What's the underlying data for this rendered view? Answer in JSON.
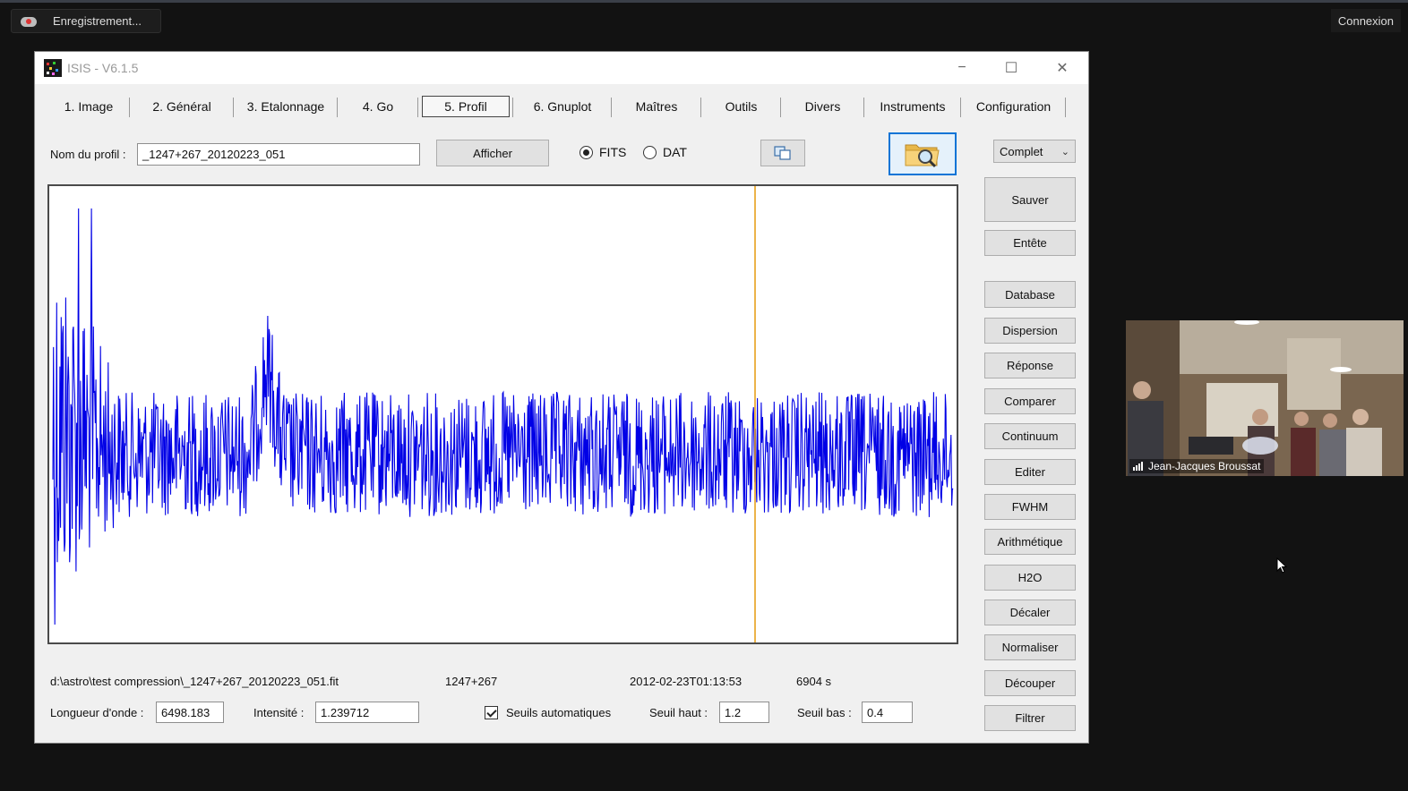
{
  "overlay": {
    "recording_label": "Enregistrement...",
    "connexion_label": "Connexion",
    "participant_name": "Jean-Jacques Broussat"
  },
  "window": {
    "title": "ISIS - V6.1.5",
    "controls": {
      "minimize": "−",
      "maximize": "☐",
      "close": "✕"
    }
  },
  "tabs": [
    {
      "label": "1. Image"
    },
    {
      "label": "2. Général"
    },
    {
      "label": "3. Etalonnage"
    },
    {
      "label": "4. Go"
    },
    {
      "label": "5. Profil",
      "active": true
    },
    {
      "label": "6. Gnuplot"
    },
    {
      "label": "Maîtres"
    },
    {
      "label": "Outils"
    },
    {
      "label": "Divers"
    },
    {
      "label": "Instruments"
    },
    {
      "label": "Configuration"
    }
  ],
  "toolbar": {
    "profile_label": "Nom du profil :",
    "profile_value": "_1247+267_20120223_051",
    "afficher_label": "Afficher",
    "format_fits": "FITS",
    "format_dat": "DAT",
    "selected_format": "FITS",
    "view_mode": "Complet"
  },
  "side_buttons": {
    "sauver": "Sauver",
    "entete": "Entête",
    "database": "Database",
    "dispersion": "Dispersion",
    "reponse": "Réponse",
    "comparer": "Comparer",
    "continuum": "Continuum",
    "editer": "Editer",
    "fwhm": "FWHM",
    "arithmetique": "Arithmétique",
    "h2o": "H2O",
    "decaler": "Décaler",
    "normaliser": "Normaliser",
    "decouper": "Découper",
    "filtrer": "Filtrer"
  },
  "status": {
    "file_path": "d:\\astro\\test compression\\_1247+267_20120223_051.fit",
    "object": "1247+267",
    "date_time": "2012-02-23T01:13:53",
    "exposure": "6904 s"
  },
  "fields": {
    "wavelength_label": "Longueur d'onde :",
    "wavelength_value": "6498.183",
    "intensity_label": "Intensité :",
    "intensity_value": "1.239712",
    "auto_threshold_label": "Seuils automatiques",
    "auto_threshold_checked": true,
    "seuil_haut_label": "Seuil haut :",
    "seuil_haut_value": "1.2",
    "seuil_bas_label": "Seuil bas :",
    "seuil_bas_value": "0.4"
  },
  "chart_data": {
    "type": "line",
    "series": [
      {
        "color": "#0000e6",
        "values": []
      }
    ],
    "cursor_color": "#e8a21c",
    "cursor_position_fraction": 0.778,
    "grid": false
  },
  "colors": {
    "spectrum": "#0000e6",
    "cursor": "#e8a21c",
    "focus_border": "#0a74d6"
  }
}
